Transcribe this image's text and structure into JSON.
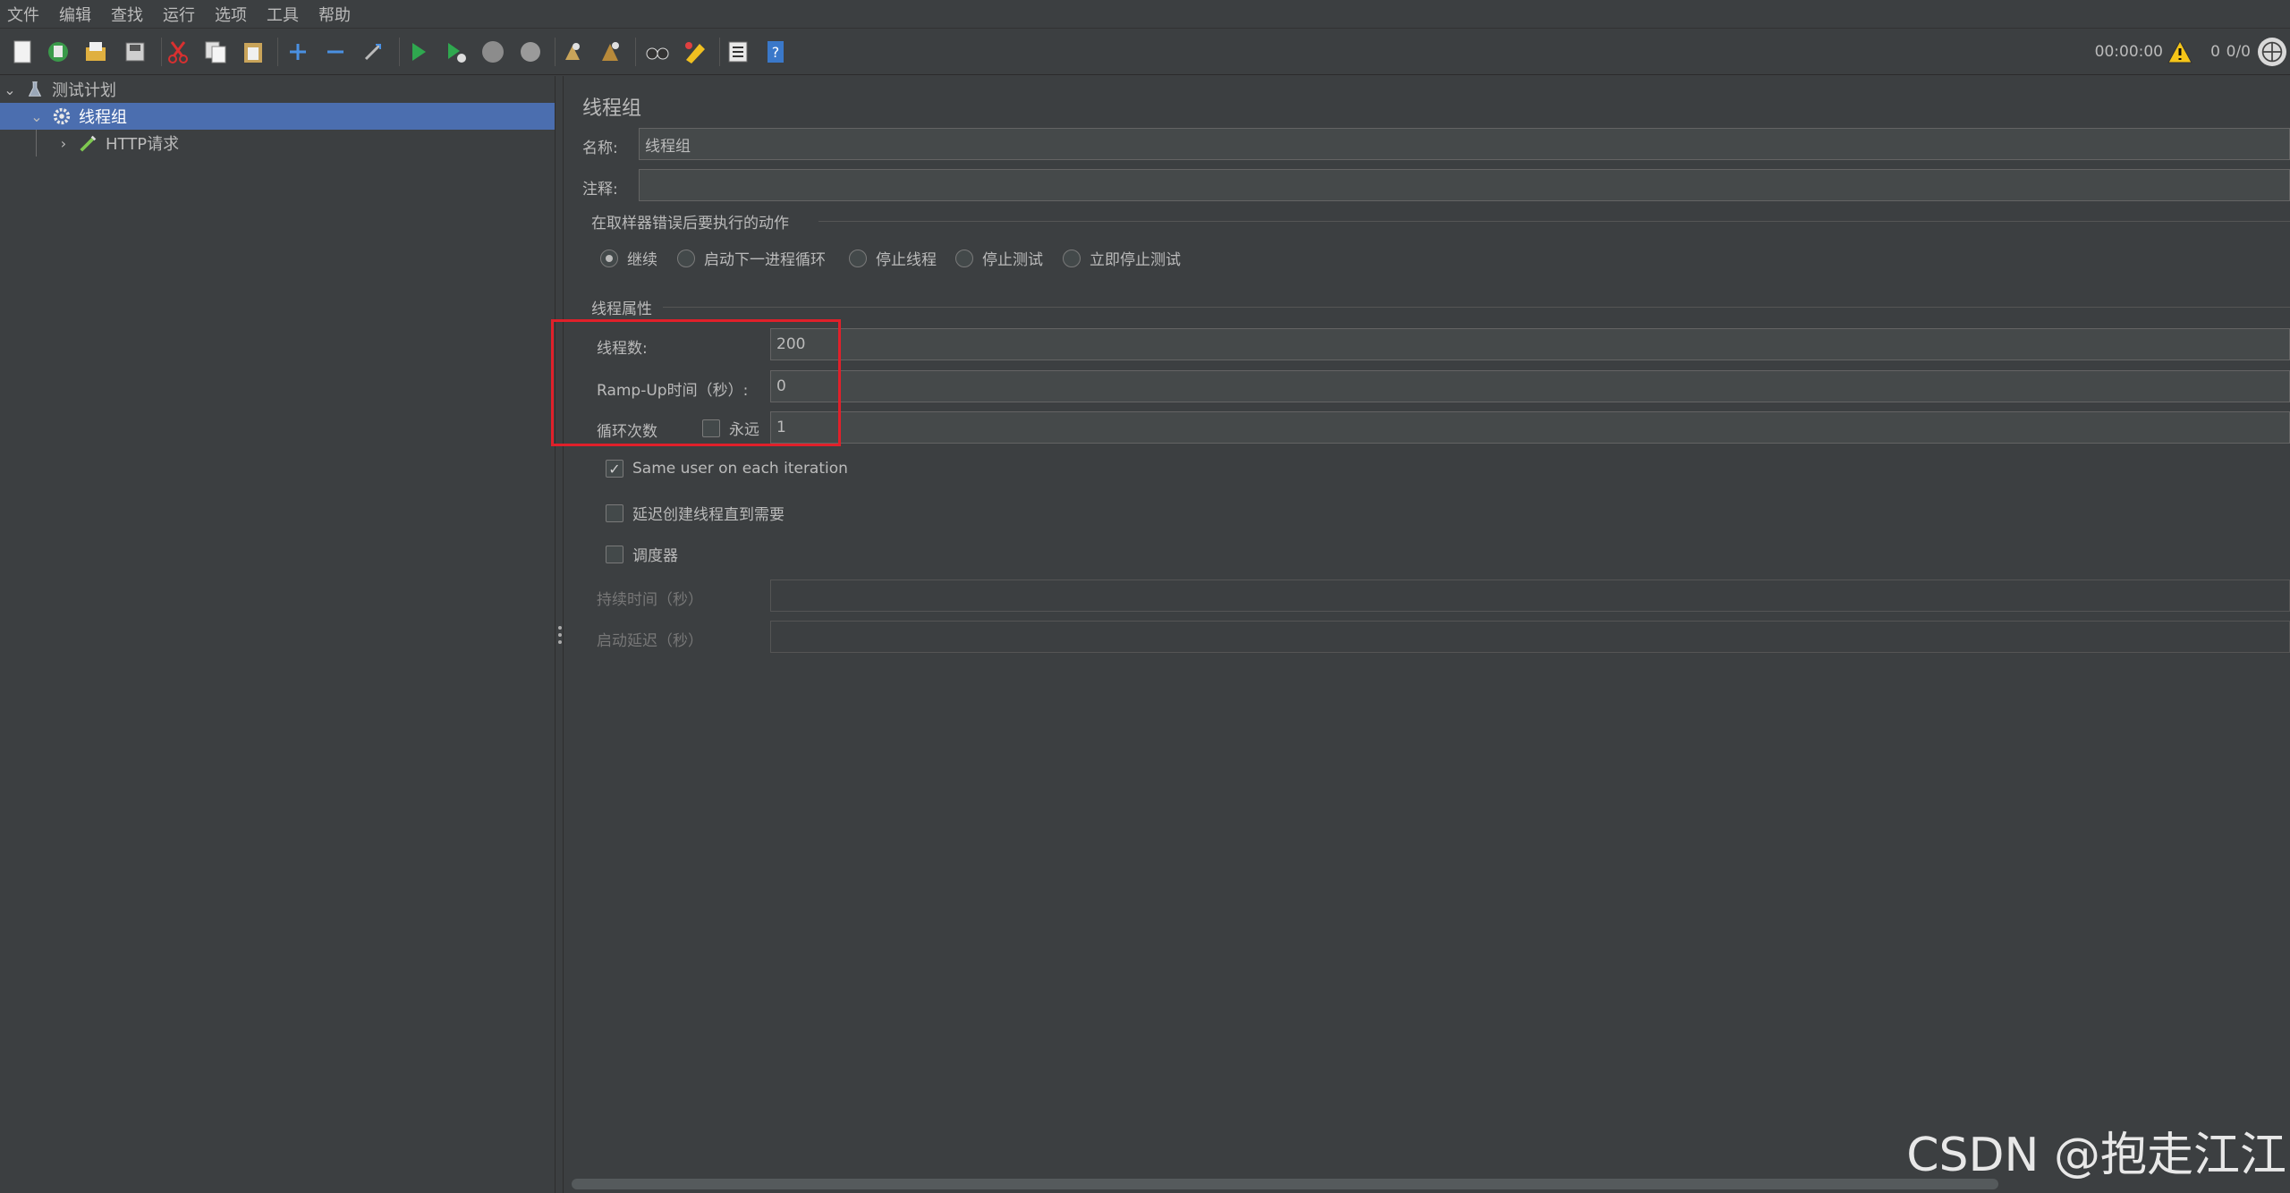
{
  "menu": [
    "文件",
    "编辑",
    "查找",
    "运行",
    "选项",
    "工具",
    "帮助"
  ],
  "toolbar": {
    "icons": [
      "new-icon",
      "templates-icon",
      "open-icon",
      "save-icon",
      "cut-icon",
      "copy-icon",
      "paste-icon",
      "expand-icon",
      "collapse-icon",
      "toggle-icon",
      "start-icon",
      "start-no-pause-icon",
      "stop-icon",
      "shutdown-icon",
      "clear-icon",
      "clear-all-icon",
      "search-icon",
      "reset-search-icon",
      "function-helper-icon",
      "help-icon"
    ],
    "elapsed": "00:00:00",
    "error_count": "0",
    "threads": "0/0"
  },
  "tree": {
    "root": "测试计划",
    "selected": "线程组",
    "child": "HTTP请求"
  },
  "panel": {
    "title": "线程组",
    "name_label": "名称:",
    "name_value": "线程组",
    "comment_label": "注释:",
    "comment_value": "",
    "error_action_title": "在取样器错误后要执行的动作",
    "error_actions": [
      "继续",
      "启动下一进程循环",
      "停止线程",
      "停止测试",
      "立即停止测试"
    ],
    "selected_action": "继续",
    "thread_props_title": "线程属性",
    "threads_label": "线程数:",
    "threads_value": "200",
    "rampup_label": "Ramp-Up时间（秒）:",
    "rampup_value": "0",
    "loop_label": "循环次数",
    "forever_label": "永远",
    "loop_value": "1",
    "same_user_label": "Same user on each iteration",
    "same_user_checked": true,
    "delay_label": "延迟创建线程直到需要",
    "scheduler_label": "调度器",
    "duration_label": "持续时间（秒）",
    "startup_delay_label": "启动延迟（秒）"
  },
  "watermark": "CSDN @抱走江江",
  "colors": {
    "highlight": "#e0202a",
    "selection": "#4b6eaf",
    "background": "#3c3f41"
  }
}
